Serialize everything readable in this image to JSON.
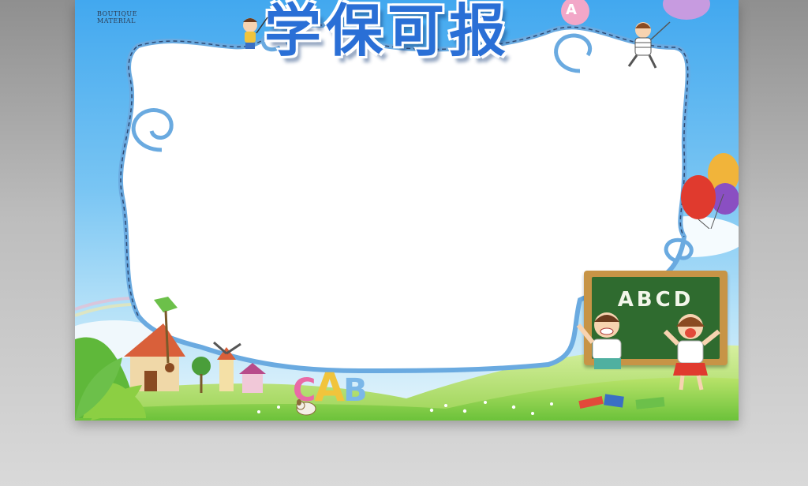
{
  "brand": {
    "tag": "",
    "line1": "BOUTIQUE",
    "line2": "MATERIAL"
  },
  "title": "学保可报",
  "chalkboard_text": "ABCD",
  "blocks": {
    "c": "C",
    "a": "A",
    "b": "B"
  },
  "balloon_letter": "A",
  "colors": {
    "sky_top": "#42a8ef",
    "frame_border": "#6aaae0",
    "grass": "#8fd14a",
    "title": "#2a6fd6"
  }
}
